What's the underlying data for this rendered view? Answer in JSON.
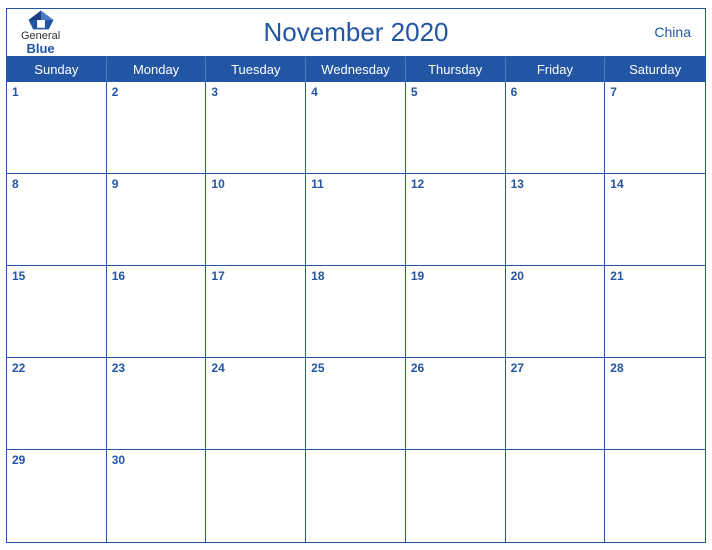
{
  "header": {
    "logo_general": "General",
    "logo_blue": "Blue",
    "title": "November 2020",
    "country": "China"
  },
  "days_of_week": [
    "Sunday",
    "Monday",
    "Tuesday",
    "Wednesday",
    "Thursday",
    "Friday",
    "Saturday"
  ],
  "weeks": [
    [
      {
        "date": "1",
        "empty": false
      },
      {
        "date": "2",
        "empty": false
      },
      {
        "date": "3",
        "empty": false
      },
      {
        "date": "4",
        "empty": false
      },
      {
        "date": "5",
        "empty": false
      },
      {
        "date": "6",
        "empty": false
      },
      {
        "date": "7",
        "empty": false
      }
    ],
    [
      {
        "date": "8",
        "empty": false
      },
      {
        "date": "9",
        "empty": false
      },
      {
        "date": "10",
        "empty": false
      },
      {
        "date": "11",
        "empty": false
      },
      {
        "date": "12",
        "empty": false
      },
      {
        "date": "13",
        "empty": false
      },
      {
        "date": "14",
        "empty": false
      }
    ],
    [
      {
        "date": "15",
        "empty": false
      },
      {
        "date": "16",
        "empty": false
      },
      {
        "date": "17",
        "empty": false
      },
      {
        "date": "18",
        "empty": false
      },
      {
        "date": "19",
        "empty": false
      },
      {
        "date": "20",
        "empty": false
      },
      {
        "date": "21",
        "empty": false
      }
    ],
    [
      {
        "date": "22",
        "empty": false
      },
      {
        "date": "23",
        "empty": false
      },
      {
        "date": "24",
        "empty": false
      },
      {
        "date": "25",
        "empty": false
      },
      {
        "date": "26",
        "empty": false
      },
      {
        "date": "27",
        "empty": false
      },
      {
        "date": "28",
        "empty": false
      }
    ],
    [
      {
        "date": "29",
        "empty": false
      },
      {
        "date": "30",
        "empty": false
      },
      {
        "date": "",
        "empty": true
      },
      {
        "date": "",
        "empty": true
      },
      {
        "date": "",
        "empty": true
      },
      {
        "date": "",
        "empty": true
      },
      {
        "date": "",
        "empty": true
      }
    ]
  ],
  "colors": {
    "blue": "#2255a4",
    "white": "#ffffff"
  }
}
